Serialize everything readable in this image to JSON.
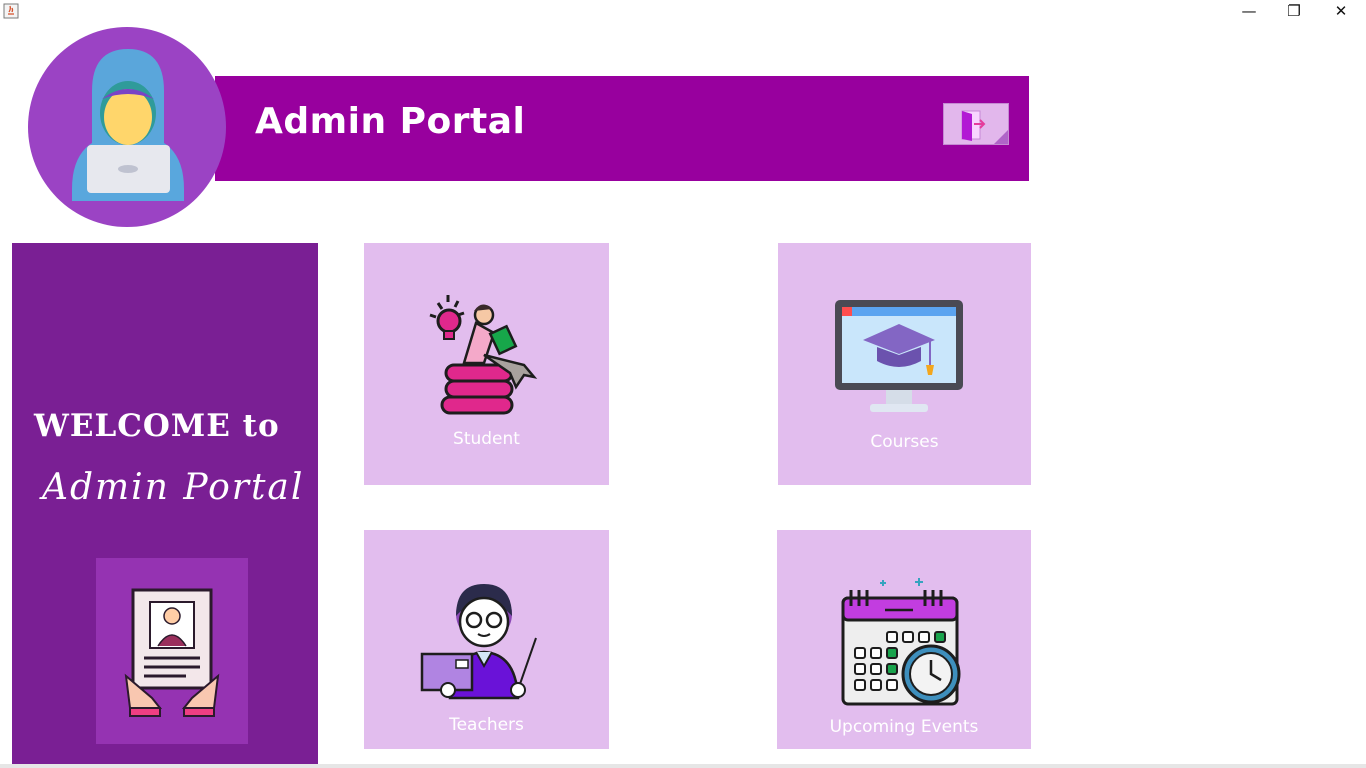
{
  "window": {
    "minimize_glyph": "—",
    "maximize_glyph": "❐",
    "close_glyph": "✕"
  },
  "header": {
    "title": "Admin Portal",
    "bar_color": "#98009e"
  },
  "sidebar": {
    "welcome_line1": "WELCOME to",
    "welcome_line2": "Admin Portal",
    "bg_color": "#7a1f94"
  },
  "cards": {
    "student": {
      "label": "Student",
      "icon": "student-books-icon"
    },
    "courses": {
      "label": "Courses",
      "icon": "graduation-monitor-icon"
    },
    "teachers": {
      "label": "Teachers",
      "icon": "teacher-icon"
    },
    "events": {
      "label": "Upcoming Events",
      "icon": "calendar-clock-icon"
    }
  },
  "colors": {
    "card_bg": "#e2bdee",
    "accent": "#98009e"
  }
}
